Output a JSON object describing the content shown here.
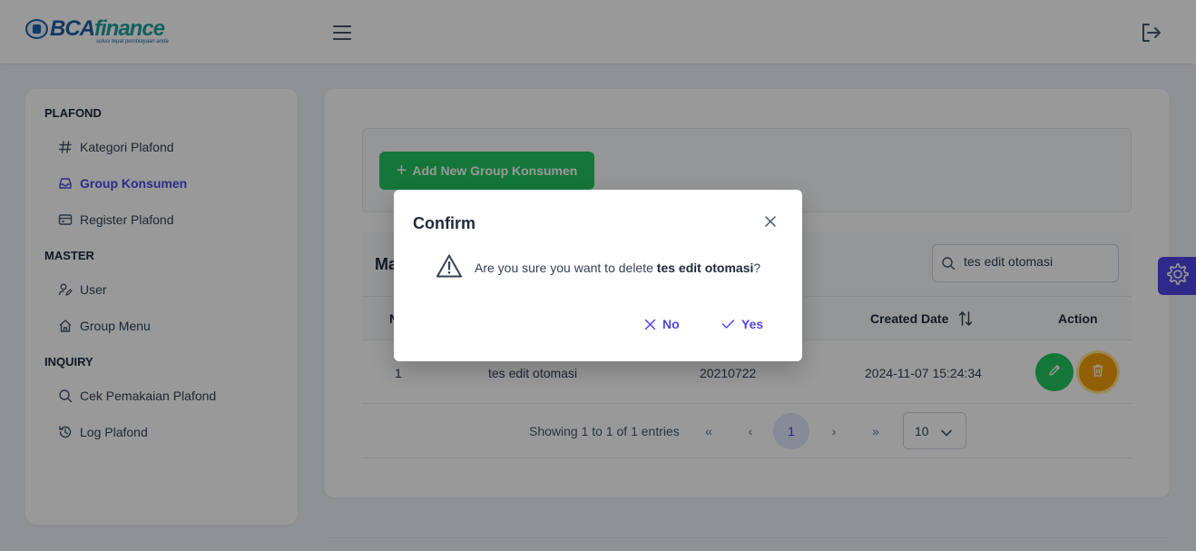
{
  "app": {
    "logo_text_1": "BCA",
    "logo_text_2": "finance",
    "logo_tagline": "solusi tepat pembiayaan anda",
    "brand_colors": {
      "blue": "#1d5fa6",
      "teal": "#1fa19a"
    },
    "accent_color": "#4f46e5"
  },
  "topbar": {
    "menu_icon": "hamburger-icon",
    "logout_icon": "logout-icon"
  },
  "sidebar": {
    "sections": [
      {
        "title": "PLAFOND",
        "items": [
          {
            "label": "Kategori Plafond",
            "icon": "hash-icon"
          },
          {
            "label": "Group Konsumen",
            "icon": "inbox-icon",
            "active": true
          },
          {
            "label": "Register Plafond",
            "icon": "credit-card-icon"
          }
        ]
      },
      {
        "title": "MASTER",
        "items": [
          {
            "label": "User",
            "icon": "user-edit-icon"
          },
          {
            "label": "Group Menu",
            "icon": "home-icon"
          }
        ]
      },
      {
        "title": "INQUIRY",
        "items": [
          {
            "label": "Cek Pemakaian Plafond",
            "icon": "search-icon"
          },
          {
            "label": "Log Plafond",
            "icon": "history-icon"
          }
        ]
      }
    ]
  },
  "main": {
    "add_button": "Add New Group Konsumen",
    "table_title": "Ma",
    "search_value": "tes edit otomasi",
    "columns": {
      "no": "N",
      "created_date": "Created Date",
      "action": "Action"
    },
    "rows": [
      {
        "no": "1",
        "name": "tes edit otomasi",
        "code": "20210722",
        "created": "2024-11-07 15:24:34"
      }
    ],
    "pagination": {
      "info": "Showing 1 to 1 of 1 entries",
      "first": "«",
      "prev": "‹",
      "current": "1",
      "next": "›",
      "last": "»",
      "rows_per_page": "10"
    }
  },
  "dialog": {
    "title": "Confirm",
    "message_prefix": "Are you sure you want to delete ",
    "message_target": "tes edit otomasi",
    "message_suffix": "?",
    "no_label": "No",
    "yes_label": "Yes"
  }
}
